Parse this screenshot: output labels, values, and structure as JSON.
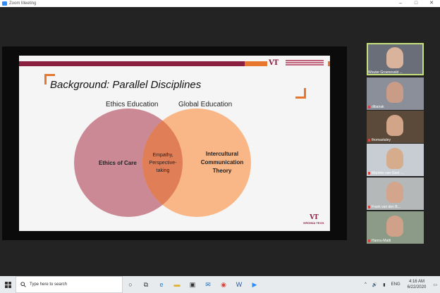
{
  "window": {
    "title": "Zoom Meeting",
    "minimize": "–",
    "maximize": "□",
    "close": "✕"
  },
  "slide": {
    "title": "Background: Parallel Disciplines",
    "left_circle_heading": "Ethics Education",
    "right_circle_heading": "Global Education",
    "left_circle_text": "Ethics of Care",
    "overlap_text": [
      "Empathy,",
      "Perspective-",
      "taking"
    ],
    "right_circle_text": [
      "Intercultural",
      "Communication",
      "Theory"
    ],
    "footer_brand": "VIRGINIA TECH.",
    "colors": {
      "maroon": "#8b1f3f",
      "orange": "#e8772e",
      "left_circle": "#c77f8c",
      "right_circle": "#f8b07c",
      "overlap": "#e07e57"
    }
  },
  "participants": [
    {
      "name": "Wouter Groeneveld ...",
      "active": true,
      "muted": false,
      "bg": "#6a6e78",
      "face": "#d9b39b"
    },
    {
      "name": "dibairak",
      "active": false,
      "muted": true,
      "bg": "#8a8f9a",
      "face": "#c89c86"
    },
    {
      "name": "thomastaley",
      "active": false,
      "muted": true,
      "bg": "#5b4a3a",
      "face": "#d2a488"
    },
    {
      "name": "Marieke van Geel -...",
      "active": false,
      "muted": true,
      "bg": "#c7cdd3",
      "face": "#d6ad8c"
    },
    {
      "name": "Frank van den B...",
      "active": false,
      "muted": true,
      "bg": "#b5b8b9",
      "face": "#d3a58c"
    },
    {
      "name": "Hannu-Matti",
      "active": false,
      "muted": true,
      "bg": "#8c9a88",
      "face": "#d0a189"
    }
  ],
  "taskbar": {
    "search_placeholder": "Type here to search",
    "icons": [
      "cortana-icon",
      "task-view-icon",
      "edge-icon",
      "file-explorer-icon",
      "store-icon",
      "mail-icon",
      "chrome-icon",
      "word-icon",
      "zoom-icon"
    ],
    "tray_language": "ENG",
    "time": "4:16 AM",
    "date": "6/22/2020"
  }
}
